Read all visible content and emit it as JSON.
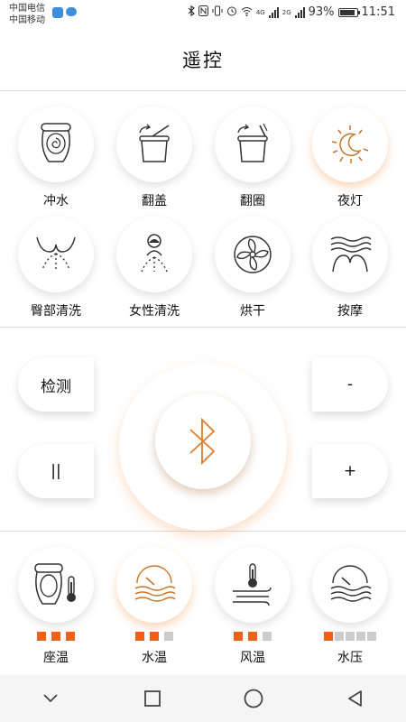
{
  "status_bar": {
    "carrier_1": "中国电信",
    "carrier_2": "中国移动",
    "battery_percent": "93%",
    "time": "11:51",
    "net_1": "4G",
    "net_2": "2G",
    "battery_level": 0.93
  },
  "header": {
    "title": "遥控"
  },
  "functions": [
    {
      "label": "冲水",
      "icon": "flush-icon"
    },
    {
      "label": "翻盖",
      "icon": "lid-flip-icon"
    },
    {
      "label": "翻圈",
      "icon": "seat-flip-icon"
    },
    {
      "label": "夜灯",
      "icon": "night-light-icon"
    },
    {
      "label": "臀部清洗",
      "icon": "rear-wash-icon"
    },
    {
      "label": "女性清洗",
      "icon": "feminine-wash-icon"
    },
    {
      "label": "烘干",
      "icon": "fan-dry-icon"
    },
    {
      "label": "按摩",
      "icon": "massage-icon"
    }
  ],
  "controls": {
    "detect_label": "检测",
    "pause_label": "||",
    "minus_label": "-",
    "plus_label": "+",
    "bluetooth_icon": "bluetooth-icon"
  },
  "temps": [
    {
      "label": "座温",
      "icon": "seat-temp-icon",
      "level": 3,
      "max": 3
    },
    {
      "label": "水温",
      "icon": "water-temp-icon",
      "level": 2,
      "max": 3
    },
    {
      "label": "风温",
      "icon": "air-temp-icon",
      "level": 2,
      "max": 3
    },
    {
      "label": "水压",
      "icon": "water-pressure-icon",
      "level": 1,
      "max": 5
    }
  ],
  "colors": {
    "accent": "#e8621a",
    "inactive": "#cccccc"
  },
  "nav": {
    "back": "chevron-down-icon",
    "recent": "square-icon",
    "home": "circle-icon",
    "return": "triangle-back-icon"
  }
}
